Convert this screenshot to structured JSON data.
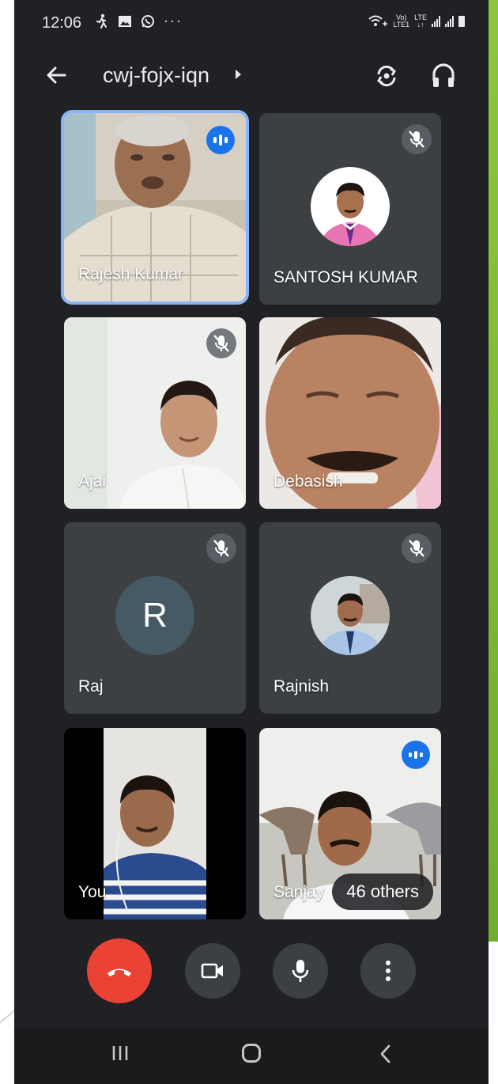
{
  "status_bar": {
    "time": "12:06",
    "left_icons": [
      "walking-icon",
      "gallery-icon",
      "whatsapp-icon",
      "more-dots-icon"
    ],
    "more_glyph": "···",
    "right_icons": [
      "wifi-calling-icon",
      "volte-lte-icon",
      "signal-icon",
      "signal-icon",
      "battery-icon"
    ],
    "vo_text": "Vo)",
    "lte1_text": "LTE1",
    "lte_text": "LTE"
  },
  "header": {
    "meeting_code": "cwj-fojx-iqn",
    "icons": [
      "back-arrow-icon",
      "camera-switch-icon",
      "headphones-icon"
    ]
  },
  "participants": [
    {
      "name": "Rajesh Kumar",
      "state": "speaking",
      "active": true,
      "tile": "video"
    },
    {
      "name": "SANTOSH KUMAR",
      "state": "muted",
      "active": false,
      "tile": "profile-photo"
    },
    {
      "name": "Ajai",
      "state": "muted",
      "active": false,
      "tile": "video"
    },
    {
      "name": "Debasish",
      "state": "unmuted",
      "active": false,
      "tile": "video"
    },
    {
      "name": "Raj",
      "state": "muted",
      "active": false,
      "tile": "letter-avatar",
      "initial": "R"
    },
    {
      "name": "Rajnish",
      "state": "muted",
      "active": false,
      "tile": "profile-photo"
    },
    {
      "name": "You",
      "state": "unmuted",
      "active": false,
      "tile": "video"
    },
    {
      "name": "Sanjay",
      "state": "speaking",
      "active": false,
      "tile": "video"
    }
  ],
  "others_chip": "46 others",
  "controls": {
    "icons": [
      "end-call-icon",
      "camera-icon",
      "microphone-icon",
      "more-options-icon"
    ]
  },
  "nav_bar": {
    "icons": [
      "recents-icon",
      "home-icon",
      "back-icon"
    ]
  },
  "colors": {
    "background": "#202124",
    "tile": "#3c4043",
    "active_border": "#8ab4f8",
    "speaking": "#1a73e8",
    "end_call": "#ea4335",
    "decor_green": "#8cc63f"
  }
}
